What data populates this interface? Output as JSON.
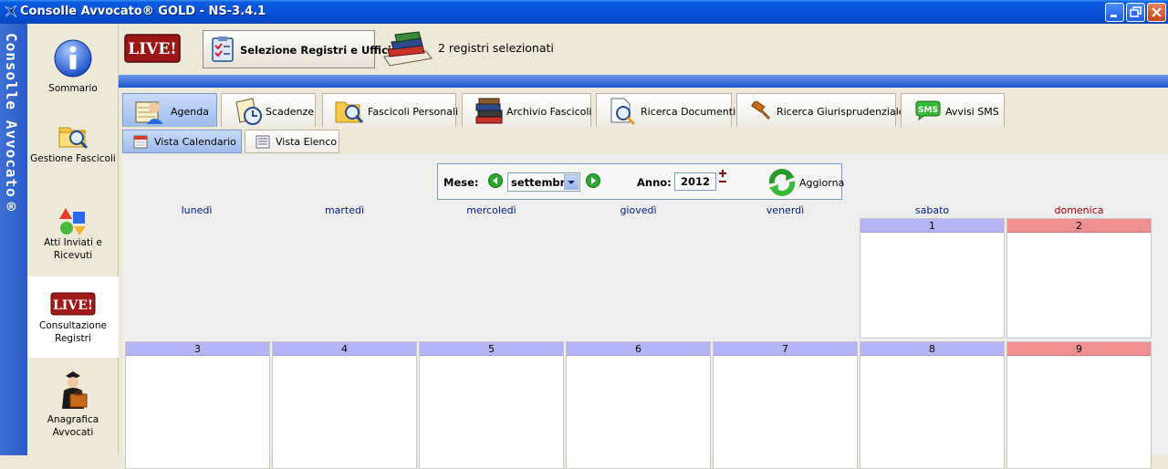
{
  "window": {
    "title": "Consolle Avvocato® GOLD - NS-3.4.1",
    "vertical_label": "Consolle Avvocato®",
    "controls": [
      "minimize-icon",
      "restore-icon",
      "close-icon"
    ]
  },
  "sidebar": {
    "items": [
      {
        "label": "Sommario",
        "icon": "info-icon",
        "active": false
      },
      {
        "label": "Gestione Fascicoli",
        "icon": "folder-search-icon",
        "active": false
      },
      {
        "label": "Atti Inviati e Ricevuti",
        "icon": "shapes-icon",
        "active": false
      },
      {
        "label": "Consultazione Registri",
        "icon": "live-icon",
        "active": true
      },
      {
        "label": "Anagrafica Avvocati",
        "icon": "lawyer-icon",
        "active": false
      }
    ]
  },
  "toolbar": {
    "live_label": "LIVE!",
    "select_button_label": "Selezione Registri e Uffici",
    "selected_count_text": "2 registri selezionati"
  },
  "tabs": [
    {
      "label": "Agenda",
      "icon": "agenda-icon",
      "active": true
    },
    {
      "label": "Scadenze",
      "icon": "deadline-icon",
      "active": false
    },
    {
      "label": "Fascicoli Personali",
      "icon": "personal-folder-icon",
      "active": false
    },
    {
      "label": "Archivio Fascicoli",
      "icon": "archive-books-icon",
      "active": false
    },
    {
      "label": "Ricerca Documenti",
      "icon": "document-search-icon",
      "active": false
    },
    {
      "label": "Ricerca Giurisprudenziale",
      "icon": "gavel-icon",
      "active": false
    },
    {
      "label": "Avvisi SMS",
      "icon": "sms-icon",
      "active": false
    }
  ],
  "subtabs": [
    {
      "label": "Vista Calendario",
      "icon": "calendar-icon",
      "active": true
    },
    {
      "label": "Vista Elenco",
      "icon": "list-icon",
      "active": false
    }
  ],
  "calendar": {
    "month_label": "Mese:",
    "month_value": "settembre",
    "year_label": "Anno:",
    "year_value": "2012",
    "refresh_label": "Aggiorna",
    "weekdays": [
      "lunedì",
      "martedì",
      "mercoledì",
      "giovedì",
      "venerdì",
      "sabato",
      "domenica"
    ],
    "week1": [
      "1",
      "2"
    ],
    "week2": [
      "3",
      "4",
      "5",
      "6",
      "7",
      "8",
      "9"
    ],
    "colors": {
      "weekday_header": "#b5b5f4",
      "sunday_header": "#f09090",
      "weekday_text": "#001a8c",
      "sunday_text": "#a00000"
    }
  }
}
